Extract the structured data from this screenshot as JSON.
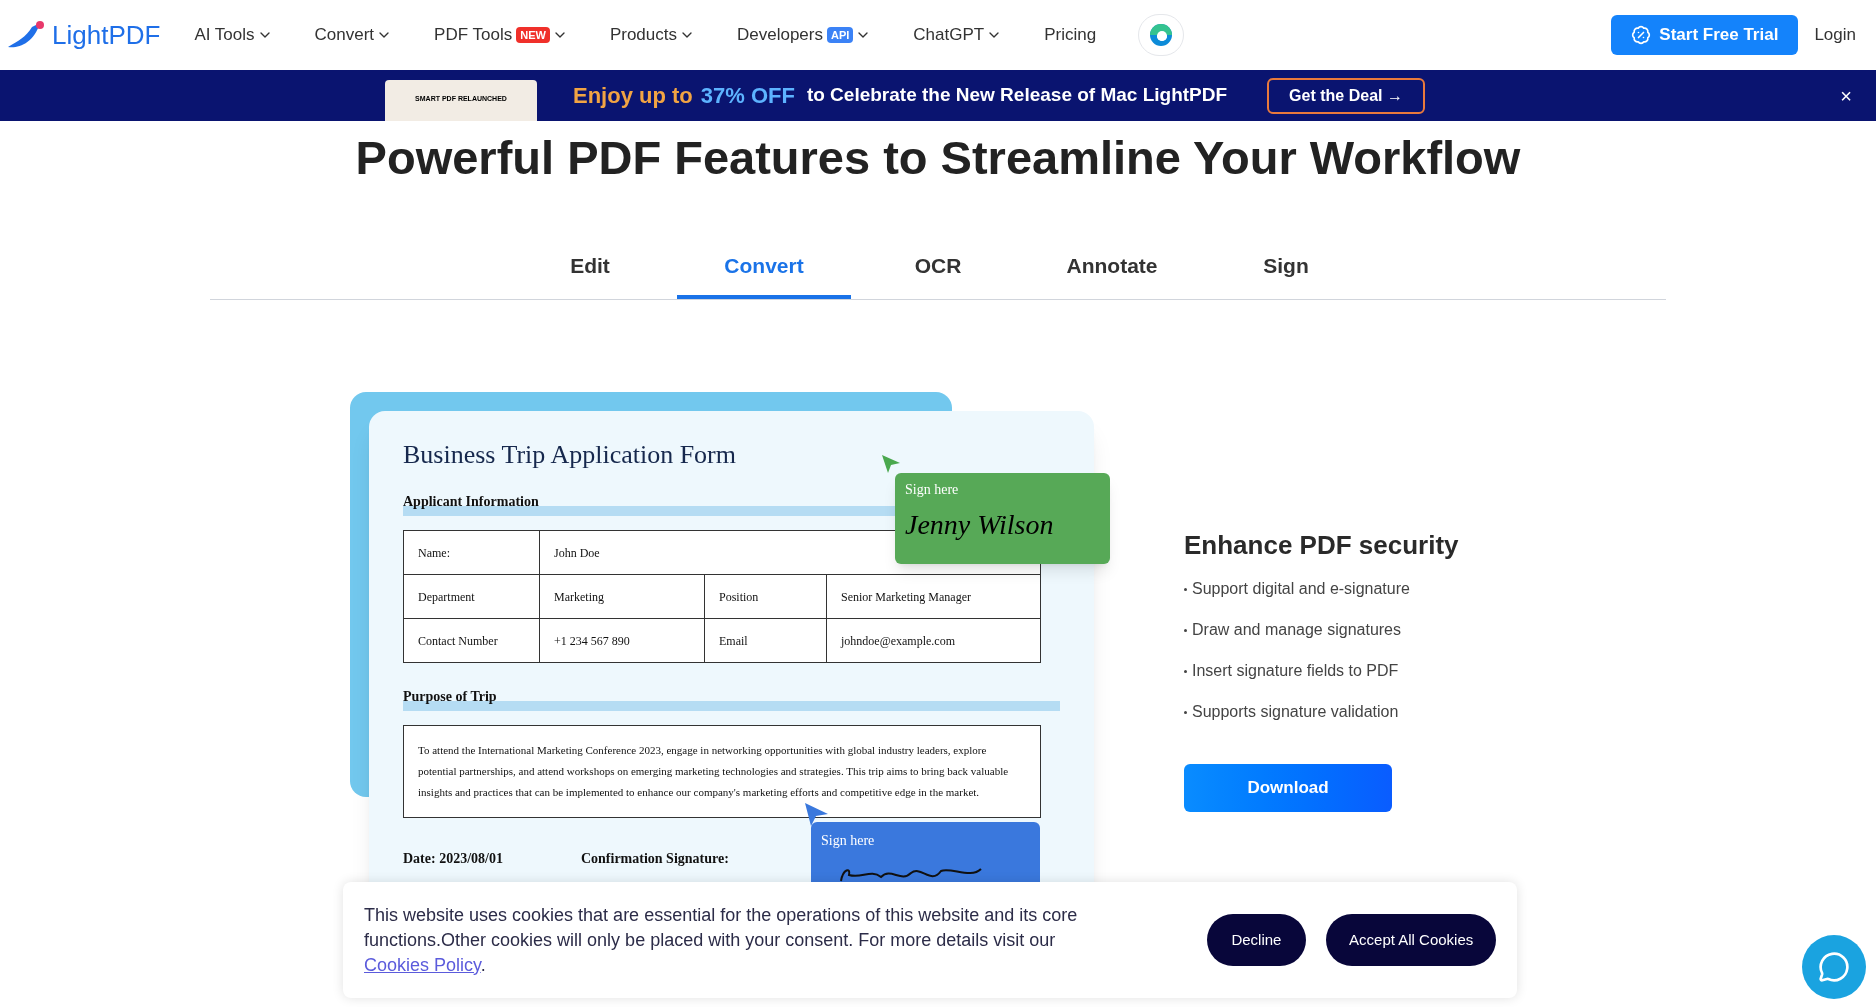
{
  "nav": {
    "logo": "LightPDF",
    "items": [
      {
        "label": "AI Tools",
        "kind": "dropdown"
      },
      {
        "label": "Convert",
        "kind": "dropdown"
      },
      {
        "label": "PDF Tools",
        "kind": "dropdown",
        "badge": "NEW",
        "color": "#f0302a"
      },
      {
        "label": "Products",
        "kind": "dropdown"
      },
      {
        "label": "Developers",
        "kind": "dropdown",
        "badge": "API",
        "color": "#3b82f6"
      },
      {
        "label": "ChatGPT",
        "kind": "dropdown"
      },
      {
        "label": "Pricing",
        "kind": "link"
      }
    ],
    "trial_button": "Start Free Trial",
    "login": "Login"
  },
  "promo": {
    "thumbnail_text": "SMART PDF RELAUNCHED",
    "highlight_a": "Enjoy up to",
    "highlight_b": "37% OFF",
    "text": "to Celebrate the New Release of Mac LightPDF",
    "button": "Get the Deal →",
    "close": "×"
  },
  "heading": "Powerful PDF Features to Streamline Your Workflow",
  "tabs": [
    {
      "label": "Edit",
      "selected": false
    },
    {
      "label": "Convert",
      "selected": true
    },
    {
      "label": "OCR",
      "selected": false
    },
    {
      "label": "Annotate",
      "selected": false
    },
    {
      "label": "Sign",
      "selected": false
    }
  ],
  "form": {
    "title": "Business Trip Application Form",
    "section_1": "Applicant Information",
    "rows": [
      [
        {
          "text": "Name:"
        },
        {
          "text": "John Doe",
          "colspan": 3
        }
      ],
      [
        {
          "text": "Department"
        },
        {
          "text": "Marketing"
        },
        {
          "text": "Position"
        },
        {
          "text": "Senior Marketing Manager"
        }
      ],
      [
        {
          "text": "Contact Number"
        },
        {
          "text": "+1 234 567 890"
        },
        {
          "text": "Email"
        },
        {
          "text": "johndoe@example.com"
        }
      ]
    ],
    "section_2": "Purpose of Trip",
    "purpose": "To attend the International Marketing Conference 2023, engage in networking opportunities with global industry leaders, explore potential partnerships, and attend workshops on emerging marketing technologies and strategies. This trip aims to bring back valuable insights and practices that can be implemented to enhance our company's marketing efforts and competitive edge in the market.",
    "date": "Date: 2023/08/01",
    "confirmation": "Confirmation Signature:",
    "sign_green": {
      "label": "Sign here",
      "signature": "Jenny Wilson"
    },
    "sign_blue": {
      "label": "Sign here"
    }
  },
  "feature": {
    "title": "Enhance PDF security",
    "bullets": [
      "Support digital and e-signature",
      "Draw and manage signatures",
      "Insert signature fields to PDF",
      "Supports signature validation"
    ],
    "button": "Download"
  },
  "cookies": {
    "text": "This website uses cookies that are essential for the operations of this website and its core functions.Other cookies will only be placed with your consent. For more details visit our ",
    "link": "Cookies Policy",
    "end": ".",
    "decline": "Decline",
    "accept": "Accept All Cookies"
  }
}
